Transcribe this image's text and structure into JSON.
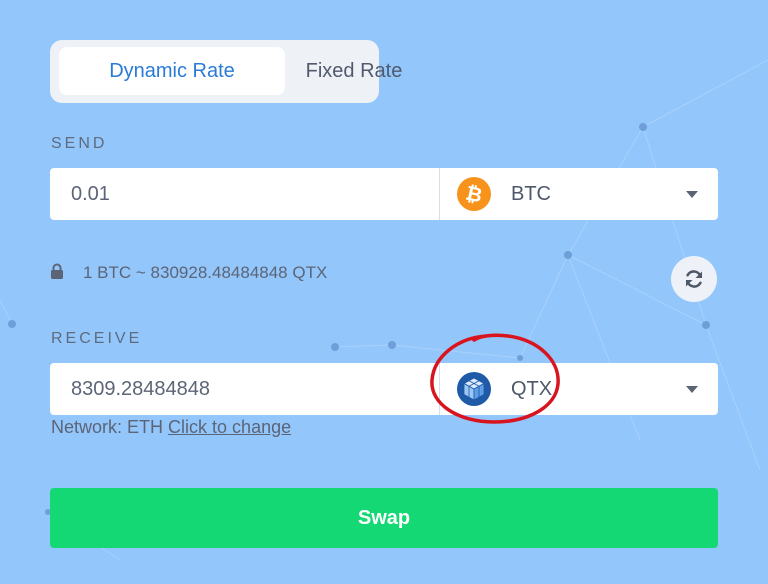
{
  "rate_toggle": {
    "dynamic_label": "Dynamic Rate",
    "fixed_label": "Fixed Rate",
    "selected": "dynamic"
  },
  "send": {
    "label": "SEND",
    "amount": "0.01",
    "currency": {
      "ticker": "BTC",
      "icon": "bitcoin-icon",
      "color": "#f7931a"
    }
  },
  "exchange_rate": {
    "icon": "lock-icon",
    "text": "1 BTC ~ 830928.48484848 QTX"
  },
  "refresh": {
    "icon": "refresh-icon"
  },
  "receive": {
    "label": "RECEIVE",
    "amount": "8309.28484848",
    "currency": {
      "ticker": "QTX",
      "icon": "qtx-cube-icon",
      "color": "#1e5aa8"
    },
    "network_prefix": "Network: ETH",
    "network_link": "Click to change"
  },
  "swap_button": {
    "label": "Swap",
    "color": "#14d874"
  },
  "colors": {
    "background": "#93c6fb",
    "accent": "#2a7bd6",
    "annotation": "#d8141e"
  }
}
